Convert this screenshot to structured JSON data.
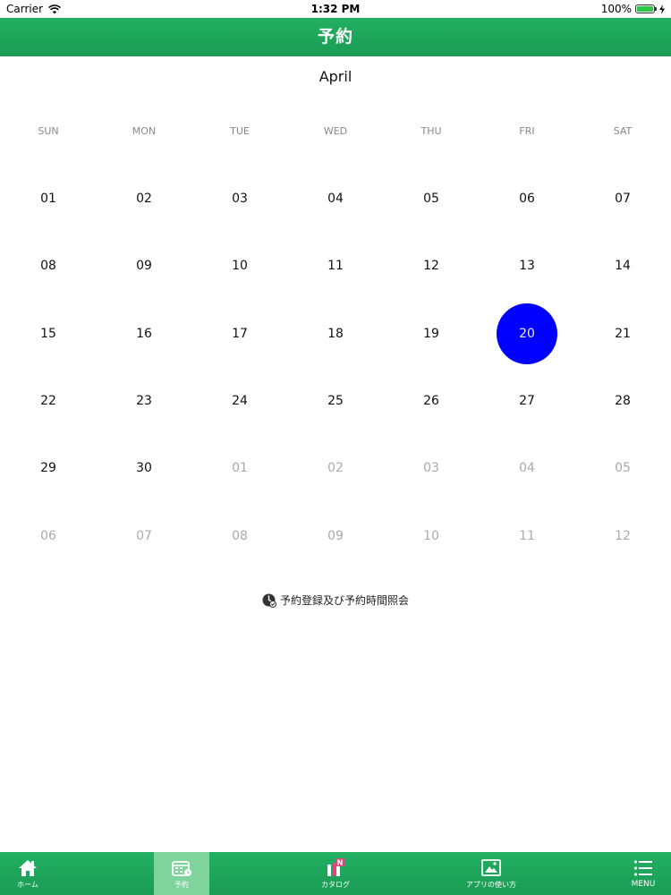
{
  "status_bar": {
    "carrier": "Carrier",
    "time": "1:32 PM",
    "battery": "100%",
    "battery_level": 1.0
  },
  "header": {
    "title": "予約"
  },
  "calendar": {
    "month": "April",
    "weekdays": [
      "SUN",
      "MON",
      "TUE",
      "WED",
      "THU",
      "FRI",
      "SAT"
    ],
    "weeks": [
      [
        "01",
        "02",
        "03",
        "04",
        "05",
        "06",
        "07"
      ],
      [
        "08",
        "09",
        "10",
        "11",
        "12",
        "13",
        "14"
      ],
      [
        "15",
        "16",
        "17",
        "18",
        "19",
        "20",
        "21"
      ],
      [
        "22",
        "23",
        "24",
        "25",
        "26",
        "27",
        "28"
      ],
      [
        "29",
        "30",
        "01",
        "02",
        "03",
        "04",
        "05"
      ],
      [
        "06",
        "07",
        "08",
        "09",
        "10",
        "11",
        "12"
      ]
    ],
    "selected_day": "20",
    "selected_color": "#0000ff",
    "current_month_day_count": 30
  },
  "reservation_link": {
    "icon": "clock-check-icon",
    "label": "予約登録及び予約時間照会"
  },
  "tab_bar": {
    "accent_color": "#1fa85b",
    "tabs": [
      {
        "label": "ホーム",
        "icon": "home-icon",
        "active": false
      },
      {
        "label": "予約",
        "icon": "calendar-icon",
        "active": true
      },
      {
        "label": "カタログ",
        "icon": "catalog-books-icon",
        "active": false,
        "badge": "N"
      },
      {
        "label": "アプリの使い方",
        "icon": "picture-frame-icon",
        "active": false
      },
      {
        "label": "MENU",
        "icon": "hamburger-menu-icon",
        "active": false
      }
    ]
  }
}
